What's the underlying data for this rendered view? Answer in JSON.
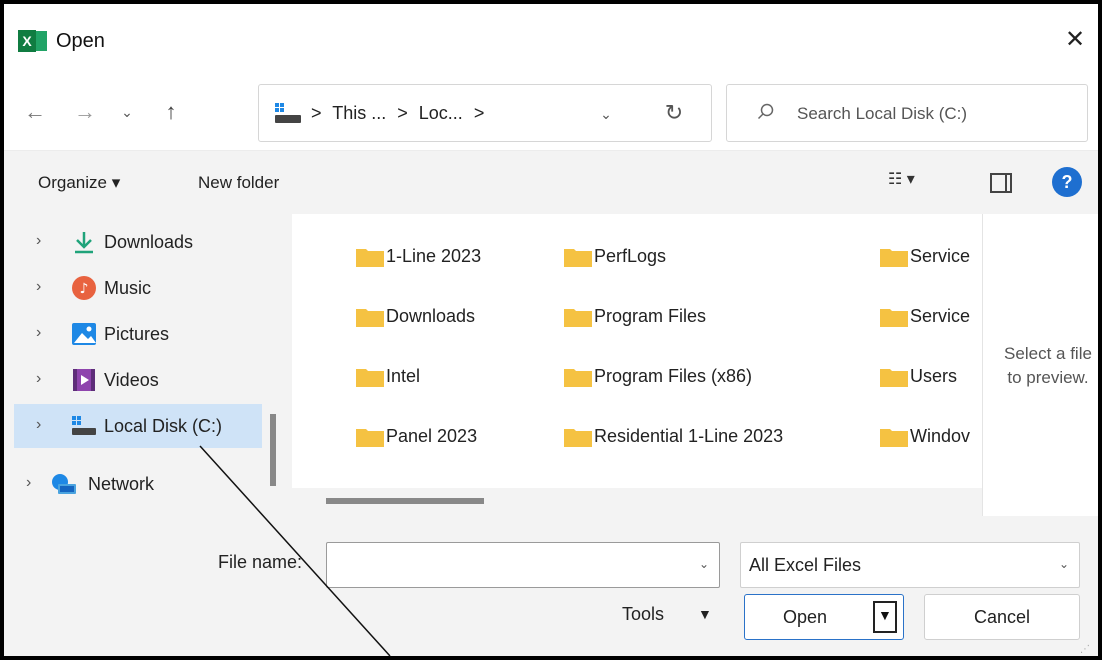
{
  "window": {
    "title": "Open",
    "app_icon": "excel-icon",
    "close_glyph": "✕"
  },
  "nav": {
    "back_glyph": "←",
    "forward_glyph": "→",
    "recent_glyph": "⌄",
    "up_glyph": "↑",
    "breadcrumbs": [
      ">",
      "This ...",
      ">",
      "Loc...",
      ">"
    ],
    "refresh_glyph": "↻",
    "search_placeholder": "Search Local Disk (C:)"
  },
  "toolbar": {
    "organize": "Organize ▾",
    "new_folder": "New folder",
    "view": "☷ ▾",
    "help": "?"
  },
  "sidebar": {
    "items": [
      {
        "label": "Downloads",
        "icon": "download-icon"
      },
      {
        "label": "Music",
        "icon": "music-icon"
      },
      {
        "label": "Pictures",
        "icon": "pictures-icon"
      },
      {
        "label": "Videos",
        "icon": "videos-icon"
      },
      {
        "label": "Local Disk (C:)",
        "icon": "drive-icon",
        "selected": true
      },
      {
        "label": "Network",
        "icon": "network-icon"
      }
    ]
  },
  "files": {
    "columns": [
      [
        "1-Line 2023",
        "Downloads",
        "Intel",
        "Panel 2023"
      ],
      [
        "PerfLogs",
        "Program Files",
        "Program Files (x86)",
        "Residential 1-Line 2023"
      ],
      [
        "Service",
        "Service",
        "Users",
        "Windov"
      ]
    ]
  },
  "preview": {
    "line1": "Select a file",
    "line2": "to preview."
  },
  "bottom": {
    "filename_label": "File name:",
    "filename_value": "",
    "filetype_value": "All Excel Files",
    "tools": "Tools",
    "tools_arrow": "▼",
    "open": "Open",
    "open_arrow": "▼",
    "cancel": "Cancel"
  },
  "colors": {
    "selection": "#cfe3f7",
    "folder": "#f5c242",
    "accent": "#2a72c8"
  }
}
